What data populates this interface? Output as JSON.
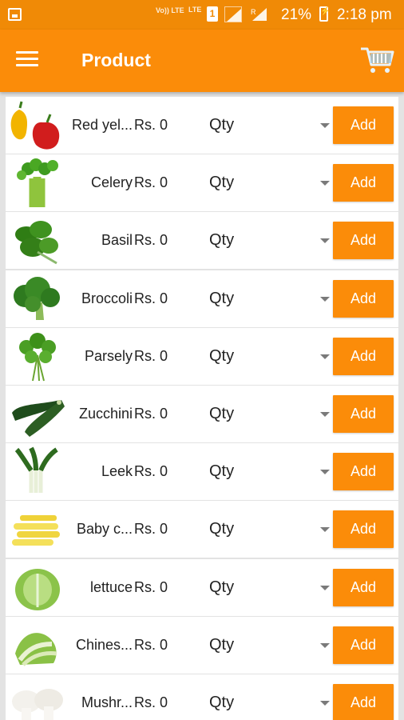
{
  "status_bar": {
    "volte": "Vo)) LTE",
    "lte": "LTE",
    "sim": "1",
    "signal_label": "R",
    "battery": "21%",
    "time": "2:18 pm",
    "icons": [
      "gallery-icon",
      "signal-icon",
      "battery-icon"
    ]
  },
  "app_bar": {
    "title": "Product",
    "menu_icon": "hamburger-menu-icon",
    "cart_icon": "shopping-cart-icon"
  },
  "colors": {
    "accent": "#fb8c09",
    "status": "#f08a06",
    "background": "#e3e3e3"
  },
  "products": [
    {
      "name": "Red yel...",
      "price": "Rs. 0",
      "qty": "Qty",
      "action": "Add",
      "image": "bell-pepper-image"
    },
    {
      "name": "Celery",
      "price": "Rs. 0",
      "qty": "Qty",
      "action": "Add",
      "image": "celery-image"
    },
    {
      "name": "Basil",
      "price": "Rs. 0",
      "qty": "Qty",
      "action": "Add",
      "image": "basil-image"
    },
    {
      "name": "Broccoli",
      "price": "Rs. 0",
      "qty": "Qty",
      "action": "Add",
      "image": "broccoli-image"
    },
    {
      "name": "Parsely",
      "price": "Rs. 0",
      "qty": "Qty",
      "action": "Add",
      "image": "parsley-image"
    },
    {
      "name": "Zucchini",
      "price": "Rs. 0",
      "qty": "Qty",
      "action": "Add",
      "image": "zucchini-image"
    },
    {
      "name": "Leek",
      "price": "Rs. 0",
      "qty": "Qty",
      "action": "Add",
      "image": "leek-image"
    },
    {
      "name": "Baby c...",
      "price": "Rs. 0",
      "qty": "Qty",
      "action": "Add",
      "image": "baby-corn-image"
    },
    {
      "name": "lettuce",
      "price": "Rs. 0",
      "qty": "Qty",
      "action": "Add",
      "image": "lettuce-image"
    },
    {
      "name": "Chines...",
      "price": "Rs. 0",
      "qty": "Qty",
      "action": "Add",
      "image": "chinese-cabbage-image"
    },
    {
      "name": "Mushr...",
      "price": "Rs. 0",
      "qty": "Qty",
      "action": "Add",
      "image": "mushroom-image"
    }
  ]
}
